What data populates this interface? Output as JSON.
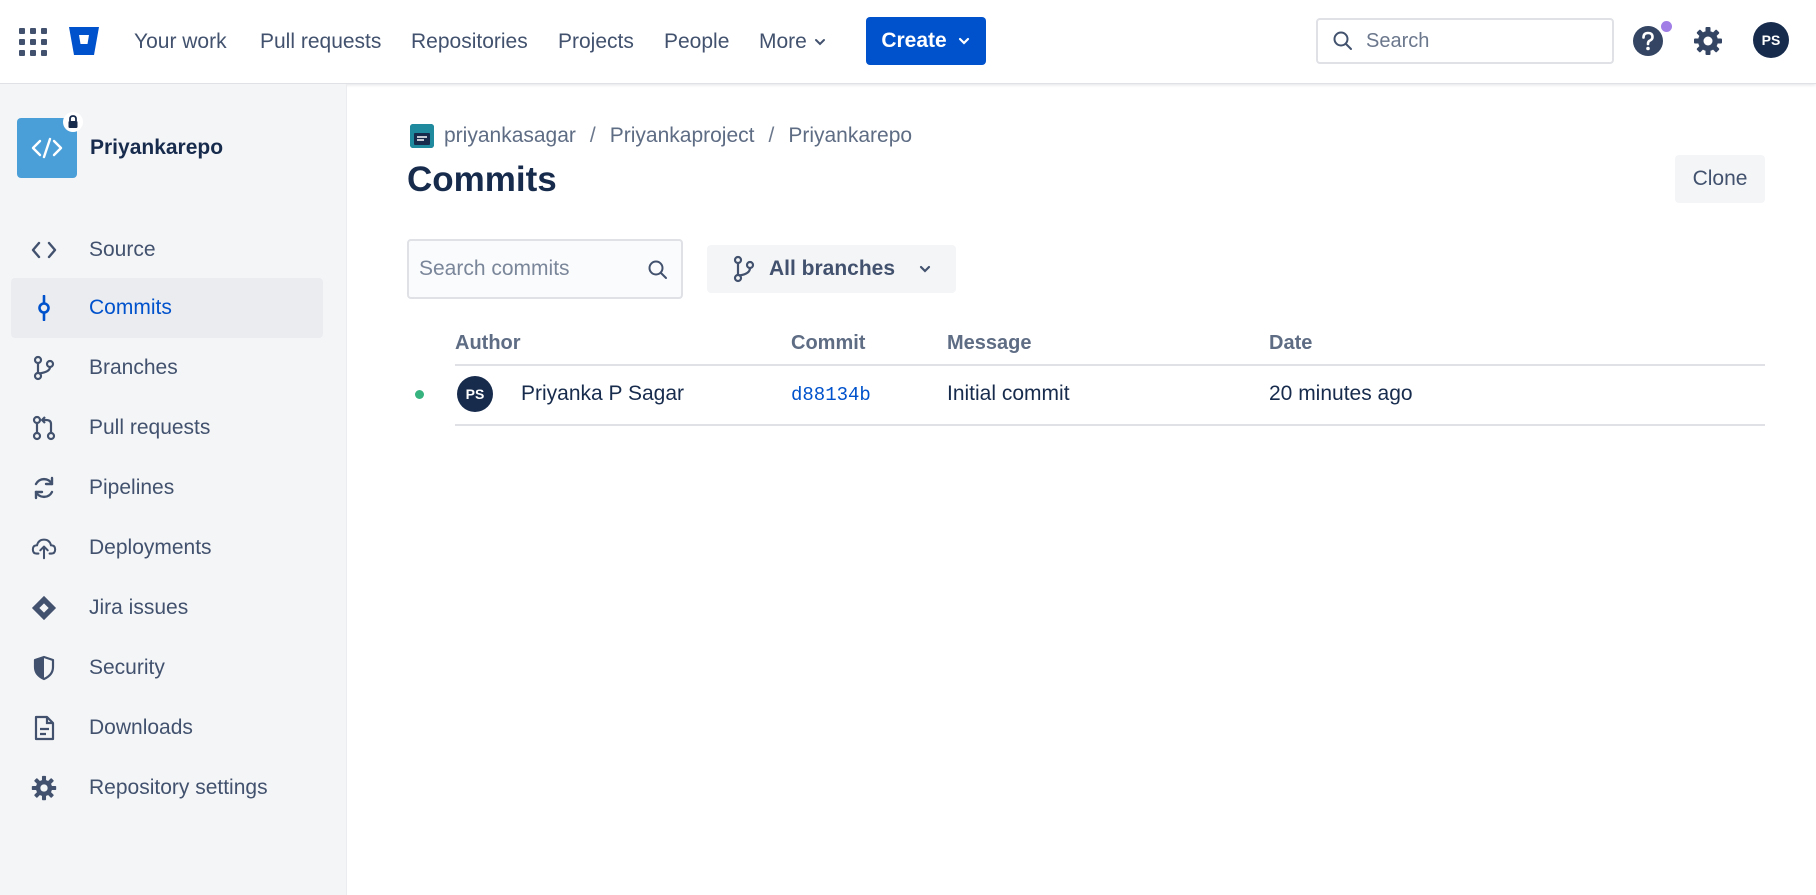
{
  "topnav": {
    "links": [
      "Your work",
      "Pull requests",
      "Repositories",
      "Projects",
      "People"
    ],
    "more_label": "More",
    "create_label": "Create",
    "search_placeholder": "Search",
    "user_initials": "PS"
  },
  "sidebar": {
    "repo_name": "Priyankarepo",
    "items": [
      {
        "label": "Source",
        "icon": "code-icon"
      },
      {
        "label": "Commits",
        "icon": "commit-icon",
        "active": true
      },
      {
        "label": "Branches",
        "icon": "branch-icon"
      },
      {
        "label": "Pull requests",
        "icon": "pull-request-icon"
      },
      {
        "label": "Pipelines",
        "icon": "pipelines-icon"
      },
      {
        "label": "Deployments",
        "icon": "cloud-upload-icon"
      },
      {
        "label": "Jira issues",
        "icon": "jira-icon"
      },
      {
        "label": "Security",
        "icon": "shield-icon"
      },
      {
        "label": "Downloads",
        "icon": "file-icon"
      },
      {
        "label": "Repository settings",
        "icon": "gear-icon"
      }
    ]
  },
  "breadcrumb": {
    "workspace": "priyankasagar",
    "project": "Priyankaproject",
    "repo": "Priyankarepo"
  },
  "main": {
    "title": "Commits",
    "clone_label": "Clone",
    "search_placeholder": "Search commits",
    "branch_filter": "All branches"
  },
  "table": {
    "columns": [
      "Author",
      "Commit",
      "Message",
      "Date"
    ],
    "rows": [
      {
        "author_initials": "PS",
        "author": "Priyanka P Sagar",
        "commit": "d88134b",
        "message": "Initial commit",
        "date": "20 minutes ago"
      }
    ]
  },
  "colors": {
    "brand_blue": "#0052cc",
    "text_primary": "#172b4d",
    "text_secondary": "#42526e",
    "sidebar_bg": "#f4f5f7",
    "build_status": "#36b37e"
  }
}
